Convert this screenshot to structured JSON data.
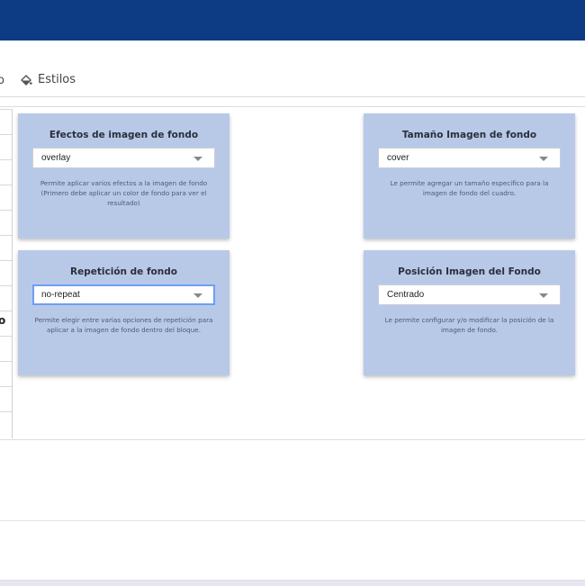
{
  "header": {
    "bar_color": "#0d3b84"
  },
  "tabs": {
    "partial_label": "o",
    "styles": {
      "label": "Estilos",
      "icon": "paint-bucket-icon"
    }
  },
  "left_list": {
    "visible_char": "o"
  },
  "cards": {
    "effects": {
      "title": "Efectos de imagen de fondo",
      "selected": "overlay",
      "description": "Permite aplicar varios efectos a la imagen de fondo (Primero debe aplicar un color de fondo para ver el resultado)"
    },
    "size": {
      "title": "Tamaño Imagen de fondo",
      "selected": "cover",
      "description": "Le permite agregar un tamaño específico para la imagen de fondo del cuadro."
    },
    "repeat": {
      "title": "Repetición de fondo",
      "selected": "no-repeat",
      "description": "Permite elegir entre varias opciones de repetición para aplicar a la imagen de fondo dentro del bloque."
    },
    "position": {
      "title": "Posición Imagen del Fondo",
      "selected": "Centrado",
      "description": "Le permite configurar y/o modificar la posición de la imagen de fondo."
    }
  },
  "colors": {
    "card_bg": "#b8c9e8",
    "focus_border": "#6e9ef2"
  }
}
